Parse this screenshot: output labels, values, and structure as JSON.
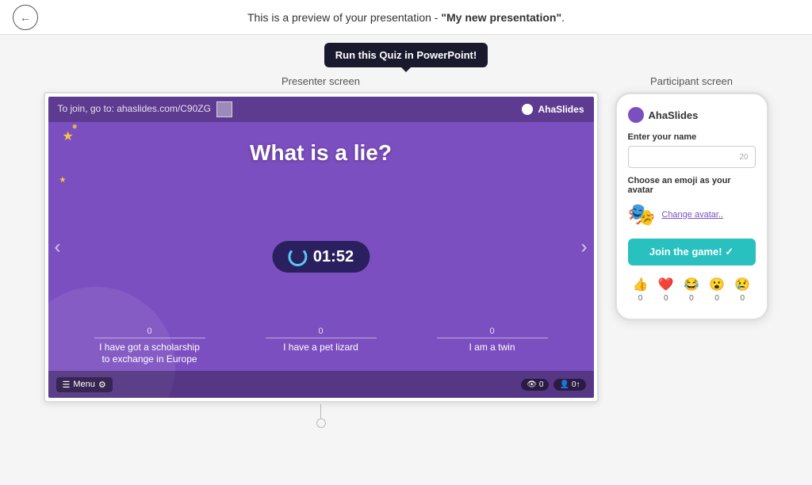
{
  "topbar": {
    "preview_text": "This is a preview of your presentation - ",
    "presentation_name": "\"My new presentation\"",
    "period": "."
  },
  "tooltip": {
    "label": "Run this Quiz in PowerPoint!"
  },
  "presenter": {
    "screen_label": "Presenter screen",
    "join_text": "To join, go to: ahaslides.com/C90ZG",
    "logo_text": "AhaSlides",
    "question": "What is a lie?",
    "timer": "01:52",
    "answers": [
      {
        "count": "0",
        "label": "I have got a scholarship\nto exchange in Europe"
      },
      {
        "count": "0",
        "label": "I have a pet lizard"
      },
      {
        "count": "0",
        "label": "I am a twin"
      }
    ],
    "menu_label": "Menu",
    "viewers_count": "0",
    "participants_count": "0↑"
  },
  "participant": {
    "screen_label": "Participant screen",
    "logo_text": "AhaSlides",
    "name_label": "Enter your name",
    "name_placeholder": "",
    "char_count": "20",
    "emoji_label": "Choose an emoji as your avatar",
    "change_avatar": "Change avatar..",
    "join_button": "Join the game! ✓",
    "reactions": [
      {
        "emoji": "👍",
        "count": "0"
      },
      {
        "emoji": "❤️",
        "count": "0"
      },
      {
        "emoji": "😂",
        "count": "0"
      },
      {
        "emoji": "😮",
        "count": "0"
      },
      {
        "emoji": "😢",
        "count": "0"
      }
    ]
  }
}
